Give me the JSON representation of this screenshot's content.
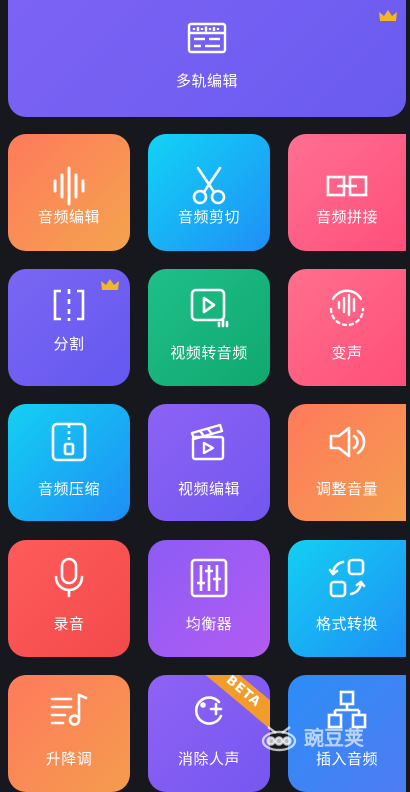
{
  "colors": {
    "background": "#16181d",
    "crown": "#f5b623",
    "beta_ribbon": "#f19c2b"
  },
  "tiles": [
    {
      "id": "multitrack",
      "label": "多轨编辑",
      "icon": "multitrack-editor-icon",
      "premium": true
    },
    {
      "id": "audio-edit",
      "label": "音频编辑",
      "icon": "waveform-icon",
      "premium": false
    },
    {
      "id": "audio-cut",
      "label": "音频剪切",
      "icon": "scissors-icon",
      "premium": false
    },
    {
      "id": "audio-join",
      "label": "音频拼接",
      "icon": "link-blocks-icon",
      "premium": false
    },
    {
      "id": "split",
      "label": "分割",
      "icon": "split-icon",
      "premium": true
    },
    {
      "id": "video-to-audio",
      "label": "视频转音频",
      "icon": "video-to-audio-icon",
      "premium": false
    },
    {
      "id": "voice-change",
      "label": "变声",
      "icon": "voice-change-icon",
      "premium": false
    },
    {
      "id": "audio-compress",
      "label": "音频压缩",
      "icon": "zip-file-icon",
      "premium": false
    },
    {
      "id": "video-edit",
      "label": "视频编辑",
      "icon": "clapperboard-icon",
      "premium": false
    },
    {
      "id": "volume-adjust",
      "label": "调整音量",
      "icon": "speaker-icon",
      "premium": false
    },
    {
      "id": "record",
      "label": "录音",
      "icon": "microphone-icon",
      "premium": false
    },
    {
      "id": "equalizer",
      "label": "均衡器",
      "icon": "equalizer-icon",
      "premium": false
    },
    {
      "id": "format-convert",
      "label": "格式转换",
      "icon": "convert-icon",
      "premium": false
    },
    {
      "id": "pitch-shift",
      "label": "升降调",
      "icon": "pitch-note-icon",
      "premium": false
    },
    {
      "id": "vocal-remove",
      "label": "消除人声",
      "icon": "vocal-remove-icon",
      "premium": false,
      "badge": "BETA"
    },
    {
      "id": "insert-audio",
      "label": "插入音频",
      "icon": "insert-audio-icon",
      "premium": false
    }
  ],
  "watermark": {
    "text": "豌豆荚",
    "icon": "pea-pod-icon"
  }
}
